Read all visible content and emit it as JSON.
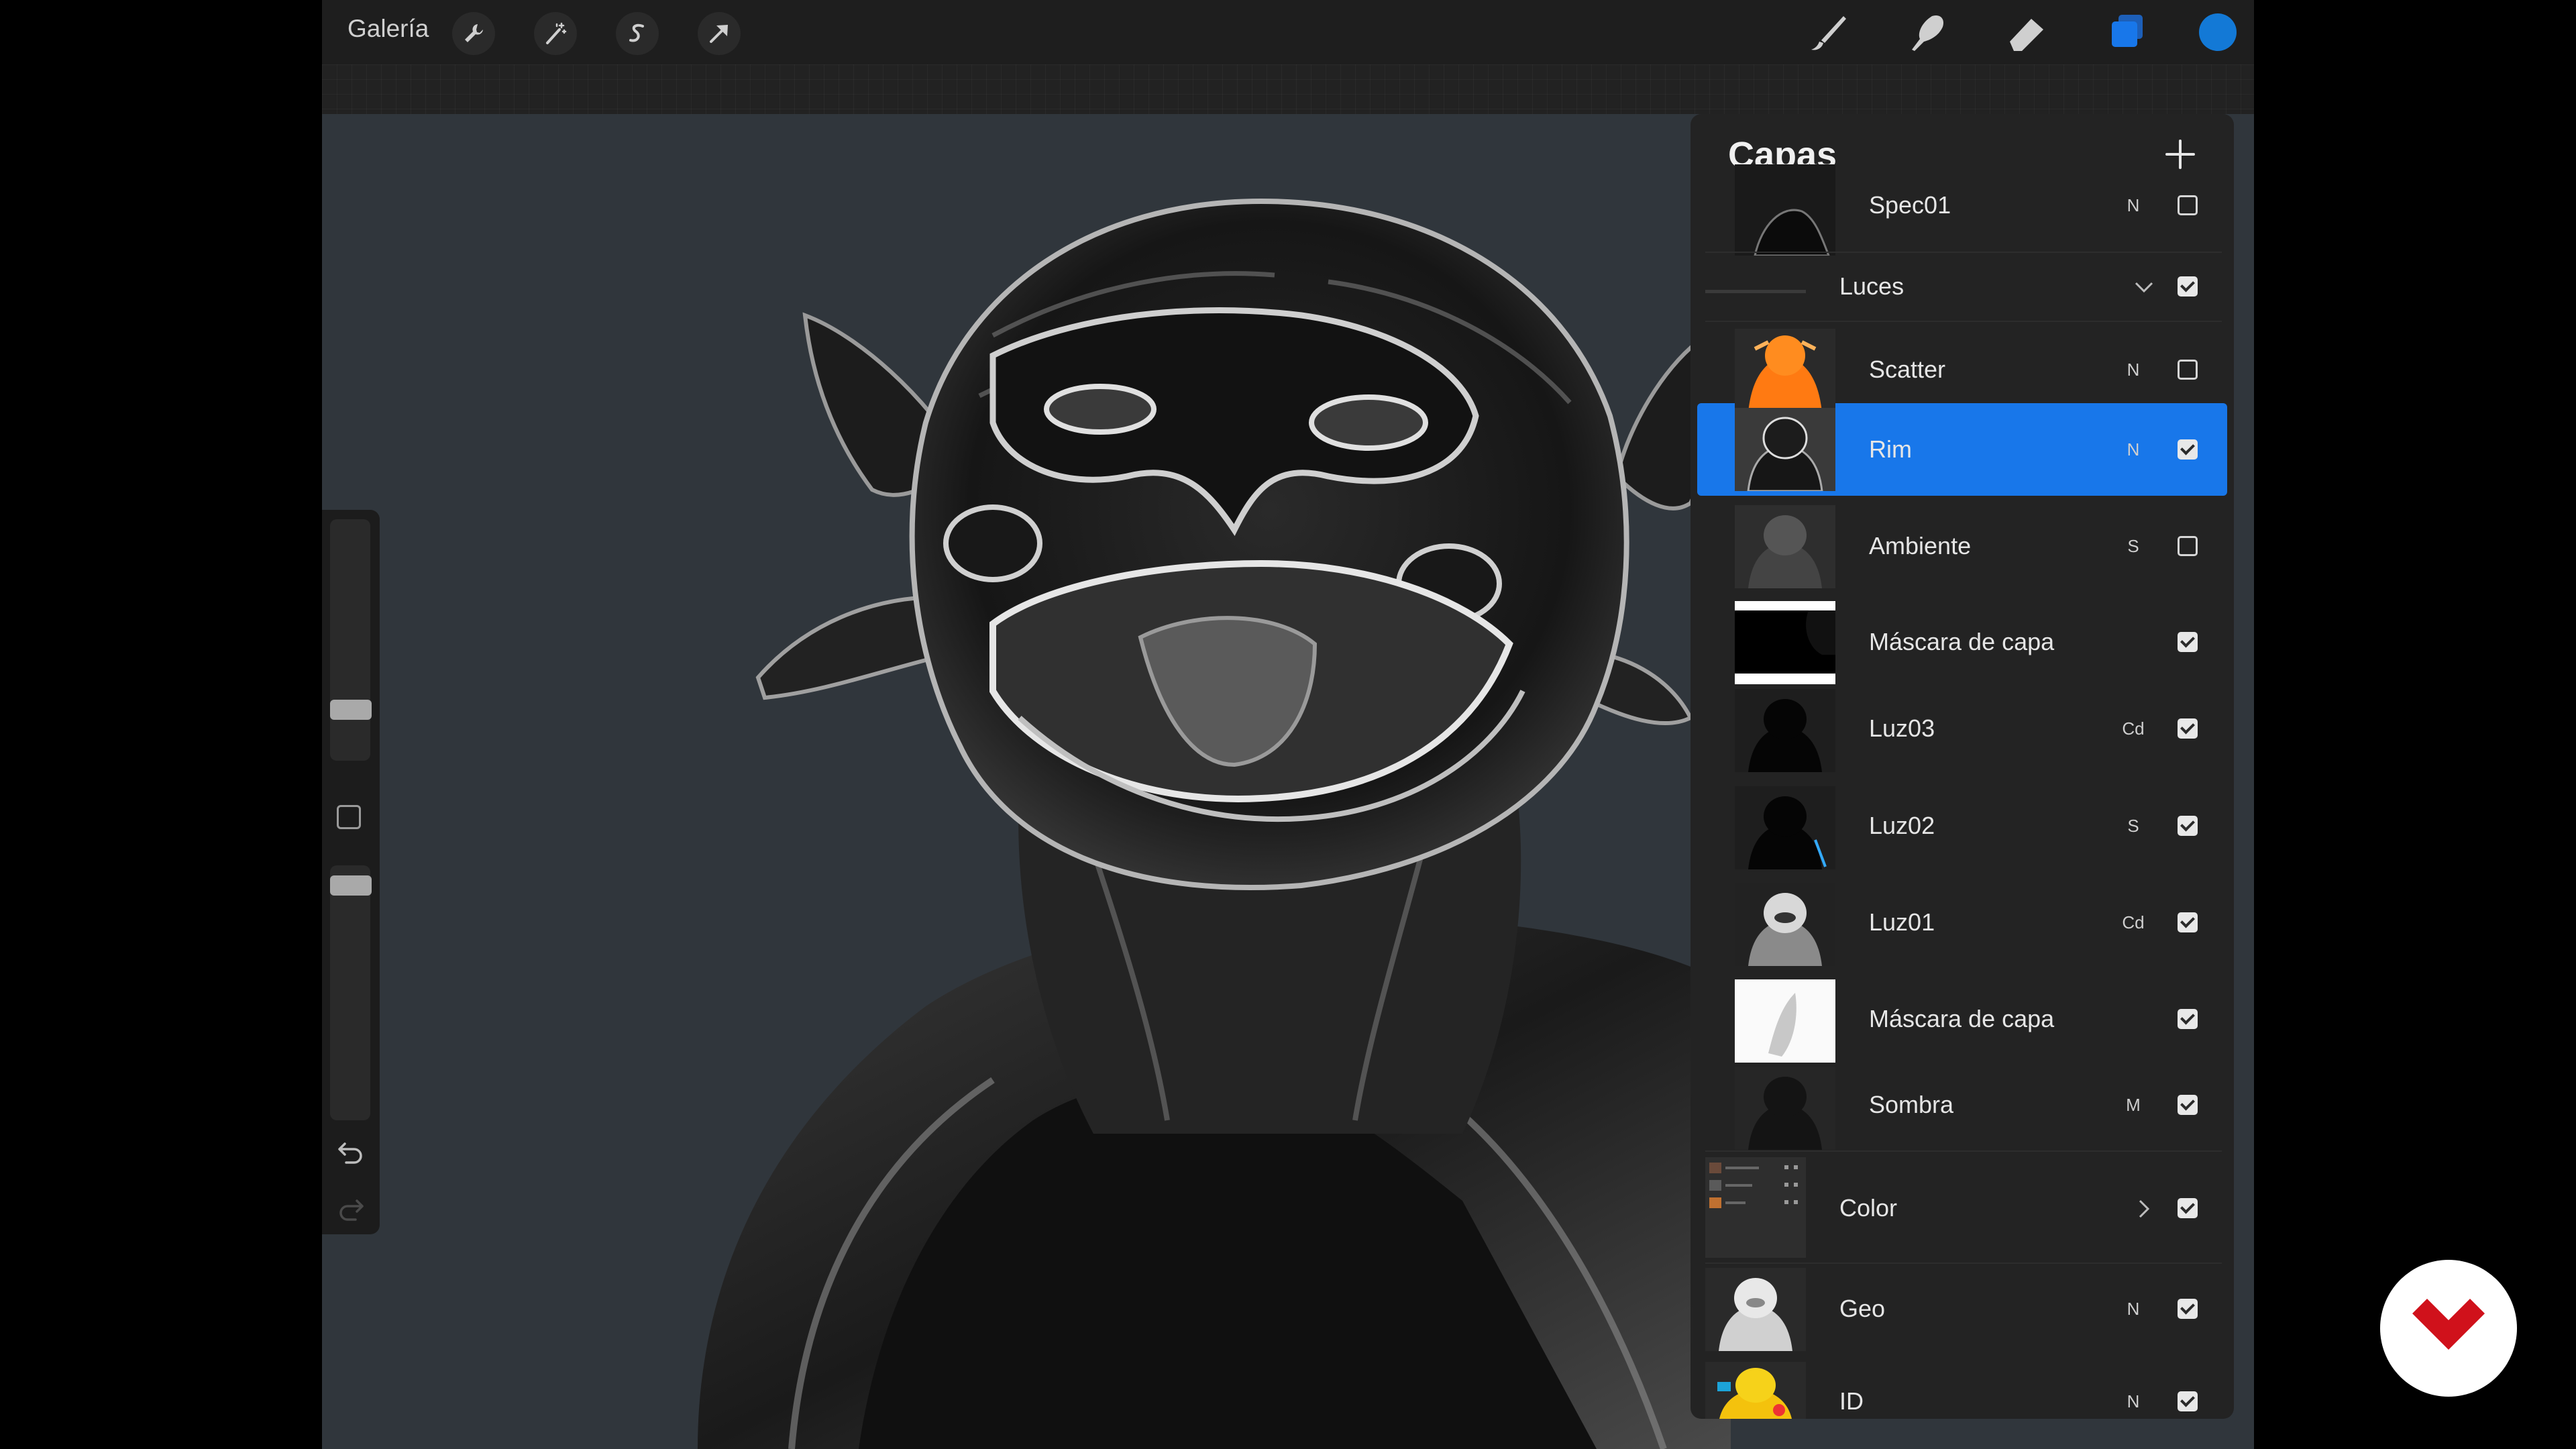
{
  "toolbar": {
    "gallery_label": "Galería",
    "left_tools": [
      "wrench-icon",
      "magic-wand-icon",
      "selection-s-icon",
      "arrow-transform-icon"
    ],
    "right_tools": [
      "brush-icon",
      "smudge-icon",
      "eraser-icon",
      "layers-icon"
    ],
    "active_color": "#1379d6"
  },
  "sidebar": {
    "brush_size_level": 0.33,
    "opacity_level": 0.6
  },
  "layers_panel": {
    "title": "Capas",
    "rows": [
      {
        "name": "Spec01",
        "blend": "N",
        "visible": false
      },
      {
        "name": "Luces",
        "group": true,
        "expanded": true,
        "visible": true
      },
      {
        "name": "Scatter",
        "blend": "N",
        "visible": false
      },
      {
        "name": "Rim",
        "blend": "N",
        "visible": true,
        "selected": true
      },
      {
        "name": "Ambiente",
        "blend": "S",
        "visible": false
      },
      {
        "name": "Máscara de capa",
        "blend": "",
        "visible": true
      },
      {
        "name": "Luz03",
        "blend": "Cd",
        "visible": true
      },
      {
        "name": "Luz02",
        "blend": "S",
        "visible": true
      },
      {
        "name": "Luz01",
        "blend": "Cd",
        "visible": true
      },
      {
        "name": "Máscara de capa",
        "blend": "",
        "visible": true
      },
      {
        "name": "Sombra",
        "blend": "M",
        "visible": true
      },
      {
        "name": "Color",
        "group": true,
        "expanded": false,
        "visible": true
      },
      {
        "name": "Geo",
        "blend": "N",
        "visible": true
      },
      {
        "name": "ID",
        "blend": "N",
        "visible": true
      }
    ]
  },
  "colors": {
    "selection": "#1877ea",
    "canvas_bg": "#30363c",
    "panel_bg": "#232323",
    "brand_red": "#d0111b"
  }
}
